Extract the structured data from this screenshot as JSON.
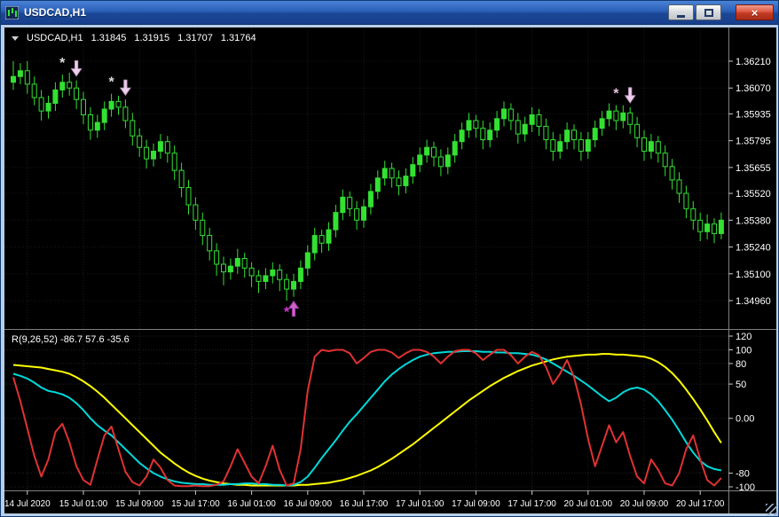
{
  "window": {
    "title": "USDCAD,H1",
    "close_glyph": "×"
  },
  "palette": {
    "candle": "#32e132",
    "grid": "#1e1e1e",
    "price_grid": "#161616",
    "ind_grid": "#202020",
    "separator": "#808080",
    "tick": "#c8c8c8",
    "axis_text": "#ffffff",
    "red": "#e03232",
    "cyan": "#00d9d9",
    "yellow": "#ffff00",
    "background": "#000000",
    "titlebar_blue": "#2a5fb8",
    "close_red": "#c23a23"
  },
  "chart": {
    "symbol_header": {
      "symbol": "USDCAD,H1",
      "open": "1.31845",
      "high": "1.31915",
      "low": "1.31707",
      "close": "1.31764"
    },
    "price_axis": [
      "1.36210",
      "1.36070",
      "1.35935",
      "1.35795",
      "1.35655",
      "1.35520",
      "1.35380",
      "1.35240",
      "1.35100",
      "1.34960"
    ],
    "time_axis": [
      {
        "i": 2,
        "label": "14 Jul 2020"
      },
      {
        "i": 10,
        "label": "15 Jul 01:00"
      },
      {
        "i": 18,
        "label": "15 Jul 09:00"
      },
      {
        "i": 26,
        "label": "15 Jul 17:00"
      },
      {
        "i": 34,
        "label": "16 Jul 01:00"
      },
      {
        "i": 42,
        "label": "16 Jul 09:00"
      },
      {
        "i": 50,
        "label": "16 Jul 17:00"
      },
      {
        "i": 58,
        "label": "17 Jul 01:00"
      },
      {
        "i": 66,
        "label": "17 Jul 09:00"
      },
      {
        "i": 74,
        "label": "17 Jul 17:00"
      },
      {
        "i": 82,
        "label": "20 Jul 01:00"
      },
      {
        "i": 90,
        "label": "20 Jul 09:00"
      },
      {
        "i": 98,
        "label": "20 Jul 17:00"
      }
    ],
    "candles": [
      [
        1.361,
        1.3621,
        1.3606,
        1.3613
      ],
      [
        1.3613,
        1.362,
        1.3609,
        1.3616
      ],
      [
        1.3616,
        1.3621,
        1.3604,
        1.3609
      ],
      [
        1.3609,
        1.3613,
        1.3598,
        1.3602
      ],
      [
        1.3602,
        1.3606,
        1.359,
        1.3595
      ],
      [
        1.3595,
        1.3603,
        1.3591,
        1.3599
      ],
      [
        1.3599,
        1.361,
        1.3595,
        1.3606
      ],
      [
        1.3606,
        1.3614,
        1.3602,
        1.361
      ],
      [
        1.361,
        1.3615,
        1.3603,
        1.3607
      ],
      [
        1.3607,
        1.3611,
        1.3596,
        1.3601
      ],
      [
        1.3601,
        1.3605,
        1.3588,
        1.3593
      ],
      [
        1.3593,
        1.3597,
        1.358,
        1.3585
      ],
      [
        1.3585,
        1.3593,
        1.3581,
        1.3589
      ],
      [
        1.3589,
        1.36,
        1.3585,
        1.3596
      ],
      [
        1.3596,
        1.3604,
        1.3592,
        1.36
      ],
      [
        1.36,
        1.3603,
        1.3593,
        1.3597
      ],
      [
        1.3597,
        1.3601,
        1.3586,
        1.359
      ],
      [
        1.359,
        1.3594,
        1.3577,
        1.3582
      ],
      [
        1.3582,
        1.3586,
        1.3571,
        1.3576
      ],
      [
        1.3576,
        1.358,
        1.3565,
        1.357
      ],
      [
        1.357,
        1.3578,
        1.3566,
        1.3574
      ],
      [
        1.3574,
        1.3583,
        1.357,
        1.3579
      ],
      [
        1.3579,
        1.3582,
        1.3568,
        1.3573
      ],
      [
        1.3573,
        1.3577,
        1.3559,
        1.3564
      ],
      [
        1.3564,
        1.3568,
        1.355,
        1.3555
      ],
      [
        1.3555,
        1.3559,
        1.3541,
        1.3546
      ],
      [
        1.3546,
        1.355,
        1.3533,
        1.3538
      ],
      [
        1.3538,
        1.3542,
        1.3525,
        1.353
      ],
      [
        1.353,
        1.3534,
        1.3517,
        1.3522
      ],
      [
        1.3522,
        1.3526,
        1.3509,
        1.3515
      ],
      [
        1.3515,
        1.3519,
        1.3504,
        1.3511
      ],
      [
        1.3511,
        1.3518,
        1.3507,
        1.3514
      ],
      [
        1.3514,
        1.3523,
        1.351,
        1.3518
      ],
      [
        1.3518,
        1.3521,
        1.3508,
        1.3513
      ],
      [
        1.3513,
        1.3516,
        1.3503,
        1.3509
      ],
      [
        1.3509,
        1.3512,
        1.35,
        1.3506
      ],
      [
        1.3506,
        1.3513,
        1.3502,
        1.3509
      ],
      [
        1.3509,
        1.3516,
        1.3505,
        1.3512
      ],
      [
        1.3512,
        1.3515,
        1.3501,
        1.3507
      ],
      [
        1.3507,
        1.351,
        1.3496,
        1.3502
      ],
      [
        1.3502,
        1.351,
        1.3498,
        1.3506
      ],
      [
        1.3506,
        1.3517,
        1.3502,
        1.3513
      ],
      [
        1.3513,
        1.3525,
        1.3509,
        1.3521
      ],
      [
        1.3521,
        1.3534,
        1.3517,
        1.353
      ],
      [
        1.353,
        1.3533,
        1.3521,
        1.3526
      ],
      [
        1.3526,
        1.3537,
        1.3522,
        1.3533
      ],
      [
        1.3533,
        1.3546,
        1.3529,
        1.3542
      ],
      [
        1.3542,
        1.3554,
        1.3538,
        1.355
      ],
      [
        1.355,
        1.3553,
        1.354,
        1.3544
      ],
      [
        1.3544,
        1.3548,
        1.3533,
        1.3538
      ],
      [
        1.3538,
        1.3549,
        1.3534,
        1.3545
      ],
      [
        1.3545,
        1.3557,
        1.3541,
        1.3553
      ],
      [
        1.3553,
        1.3564,
        1.3549,
        1.356
      ],
      [
        1.356,
        1.3569,
        1.3556,
        1.3565
      ],
      [
        1.3565,
        1.3568,
        1.3555,
        1.356
      ],
      [
        1.356,
        1.3564,
        1.3551,
        1.3556
      ],
      [
        1.3556,
        1.3565,
        1.3552,
        1.3561
      ],
      [
        1.3561,
        1.3571,
        1.3557,
        1.3567
      ],
      [
        1.3567,
        1.3576,
        1.3563,
        1.3572
      ],
      [
        1.3572,
        1.358,
        1.3568,
        1.3576
      ],
      [
        1.3576,
        1.3579,
        1.3566,
        1.3571
      ],
      [
        1.3571,
        1.3575,
        1.3561,
        1.3566
      ],
      [
        1.3566,
        1.3576,
        1.3562,
        1.3572
      ],
      [
        1.3572,
        1.3583,
        1.3568,
        1.3579
      ],
      [
        1.3579,
        1.3589,
        1.3575,
        1.3585
      ],
      [
        1.3585,
        1.3594,
        1.3581,
        1.359
      ],
      [
        1.359,
        1.3593,
        1.3581,
        1.3586
      ],
      [
        1.3586,
        1.359,
        1.3575,
        1.358
      ],
      [
        1.358,
        1.3589,
        1.3576,
        1.3585
      ],
      [
        1.3585,
        1.3595,
        1.3581,
        1.3591
      ],
      [
        1.3591,
        1.36,
        1.3587,
        1.3596
      ],
      [
        1.3596,
        1.3599,
        1.3585,
        1.359
      ],
      [
        1.359,
        1.3594,
        1.3578,
        1.3583
      ],
      [
        1.3583,
        1.3592,
        1.3579,
        1.3588
      ],
      [
        1.3588,
        1.3597,
        1.3584,
        1.3593
      ],
      [
        1.3593,
        1.3596,
        1.3582,
        1.3587
      ],
      [
        1.3587,
        1.3591,
        1.3575,
        1.358
      ],
      [
        1.358,
        1.3584,
        1.3569,
        1.3574
      ],
      [
        1.3574,
        1.3583,
        1.357,
        1.3579
      ],
      [
        1.3579,
        1.3589,
        1.3575,
        1.3585
      ],
      [
        1.3585,
        1.3588,
        1.3575,
        1.358
      ],
      [
        1.358,
        1.3584,
        1.3569,
        1.3574
      ],
      [
        1.3574,
        1.3584,
        1.357,
        1.358
      ],
      [
        1.358,
        1.359,
        1.3576,
        1.3586
      ],
      [
        1.3586,
        1.3595,
        1.3582,
        1.3591
      ],
      [
        1.3591,
        1.3599,
        1.3587,
        1.3595
      ],
      [
        1.3595,
        1.3598,
        1.3585,
        1.359
      ],
      [
        1.359,
        1.3598,
        1.3586,
        1.3594
      ],
      [
        1.3594,
        1.3597,
        1.3583,
        1.3588
      ],
      [
        1.3588,
        1.3592,
        1.3576,
        1.3581
      ],
      [
        1.3581,
        1.3585,
        1.3569,
        1.3574
      ],
      [
        1.3574,
        1.3583,
        1.357,
        1.3579
      ],
      [
        1.3579,
        1.3582,
        1.3568,
        1.3573
      ],
      [
        1.3573,
        1.3577,
        1.3561,
        1.3566
      ],
      [
        1.3566,
        1.357,
        1.3554,
        1.3559
      ],
      [
        1.3559,
        1.3563,
        1.3547,
        1.3552
      ],
      [
        1.3552,
        1.3556,
        1.3539,
        1.3544
      ],
      [
        1.3544,
        1.3548,
        1.3533,
        1.3538
      ],
      [
        1.3538,
        1.3542,
        1.3527,
        1.3532
      ],
      [
        1.3532,
        1.3541,
        1.3528,
        1.3536
      ],
      [
        1.3536,
        1.3539,
        1.3526,
        1.3531
      ],
      [
        1.3531,
        1.3542,
        1.3528,
        1.3538
      ]
    ],
    "markers": [
      {
        "i": 7,
        "type": "star",
        "pos": "above",
        "color": "#dcdcdc"
      },
      {
        "i": 9,
        "type": "arrow-down",
        "pos": "above",
        "color": "#ecd2ec",
        "stroke": "#c9a0c9"
      },
      {
        "i": 14,
        "type": "star",
        "pos": "above",
        "color": "#dcdcdc"
      },
      {
        "i": 16,
        "type": "arrow-down",
        "pos": "above",
        "color": "#ecd2ec",
        "stroke": "#c9a0c9"
      },
      {
        "i": 39,
        "type": "star",
        "pos": "below",
        "color": "#d23bd2"
      },
      {
        "i": 40,
        "type": "arrow-up",
        "pos": "below",
        "color": "#cf62cf",
        "stroke": "#9b3a9b"
      },
      {
        "i": 86,
        "type": "star",
        "pos": "above",
        "color": "#e6c3dc"
      },
      {
        "i": 88,
        "type": "arrow-down",
        "pos": "above",
        "color": "#ecd2ec",
        "stroke": "#c9a0c9"
      }
    ]
  },
  "indicator": {
    "header": "R(9,26,52) -86.7 57.6 -35.6",
    "axis": [
      {
        "v": 120,
        "label": "120"
      },
      {
        "v": 100,
        "label": "100"
      },
      {
        "v": 80,
        "label": "80"
      },
      {
        "v": 50,
        "label": "50"
      },
      {
        "v": 0,
        "label": "0.00"
      },
      {
        "v": -80,
        "label": "-80"
      },
      {
        "v": -100,
        "label": "-100"
      }
    ],
    "series": {
      "red": [
        60,
        25,
        -15,
        -55,
        -85,
        -60,
        -20,
        -8,
        -35,
        -70,
        -90,
        -97,
        -60,
        -25,
        -12,
        -45,
        -78,
        -93,
        -98,
        -85,
        -60,
        -72,
        -90,
        -98,
        -99,
        -99,
        -98,
        -99,
        -99,
        -97,
        -92,
        -70,
        -45,
        -65,
        -85,
        -95,
        -70,
        -40,
        -75,
        -98,
        -95,
        -45,
        40,
        90,
        100,
        98,
        100,
        100,
        95,
        80,
        88,
        97,
        100,
        100,
        96,
        88,
        95,
        100,
        100,
        97,
        90,
        80,
        90,
        98,
        100,
        100,
        95,
        85,
        93,
        100,
        100,
        92,
        80,
        90,
        97,
        92,
        75,
        50,
        65,
        85,
        60,
        20,
        -30,
        -70,
        -40,
        -10,
        -35,
        -20,
        -55,
        -85,
        -95,
        -60,
        -75,
        -95,
        -98,
        -80,
        -45,
        -25,
        -60,
        -90,
        -98,
        -87
      ],
      "cyan": [
        65,
        62,
        58,
        52,
        45,
        40,
        38,
        35,
        30,
        22,
        12,
        0,
        -10,
        -18,
        -25,
        -35,
        -45,
        -55,
        -65,
        -73,
        -80,
        -85,
        -89,
        -92,
        -94,
        -95,
        -96,
        -96,
        -97,
        -97,
        -97,
        -96,
        -96,
        -95,
        -95,
        -96,
        -96,
        -97,
        -97,
        -98,
        -97,
        -93,
        -85,
        -72,
        -58,
        -45,
        -32,
        -18,
        -5,
        6,
        18,
        30,
        42,
        54,
        64,
        72,
        79,
        85,
        90,
        93,
        95,
        96,
        97,
        97,
        98,
        98,
        98,
        97,
        97,
        96,
        96,
        95,
        95,
        94,
        93,
        90,
        86,
        80,
        74,
        68,
        62,
        55,
        48,
        40,
        32,
        25,
        30,
        38,
        43,
        45,
        42,
        35,
        25,
        12,
        -2,
        -18,
        -35,
        -50,
        -62,
        -70,
        -74,
        -76
      ],
      "yellow": [
        78,
        77,
        76,
        75,
        74,
        72,
        70,
        68,
        65,
        60,
        54,
        47,
        39,
        30,
        20,
        10,
        0,
        -10,
        -20,
        -30,
        -40,
        -50,
        -58,
        -66,
        -73,
        -79,
        -84,
        -88,
        -91,
        -93,
        -95,
        -96,
        -97,
        -97,
        -98,
        -98,
        -98,
        -98,
        -98,
        -98,
        -98,
        -97,
        -97,
        -96,
        -95,
        -94,
        -92,
        -90,
        -87,
        -84,
        -80,
        -76,
        -71,
        -65,
        -59,
        -52,
        -45,
        -38,
        -30,
        -22,
        -14,
        -6,
        2,
        10,
        18,
        26,
        33,
        40,
        47,
        53,
        59,
        64,
        69,
        73,
        77,
        80,
        83,
        86,
        88,
        90,
        91,
        92,
        93,
        93,
        94,
        94,
        93,
        93,
        92,
        91,
        90,
        87,
        82,
        75,
        66,
        55,
        42,
        28,
        13,
        -3,
        -20,
        -36
      ]
    }
  }
}
